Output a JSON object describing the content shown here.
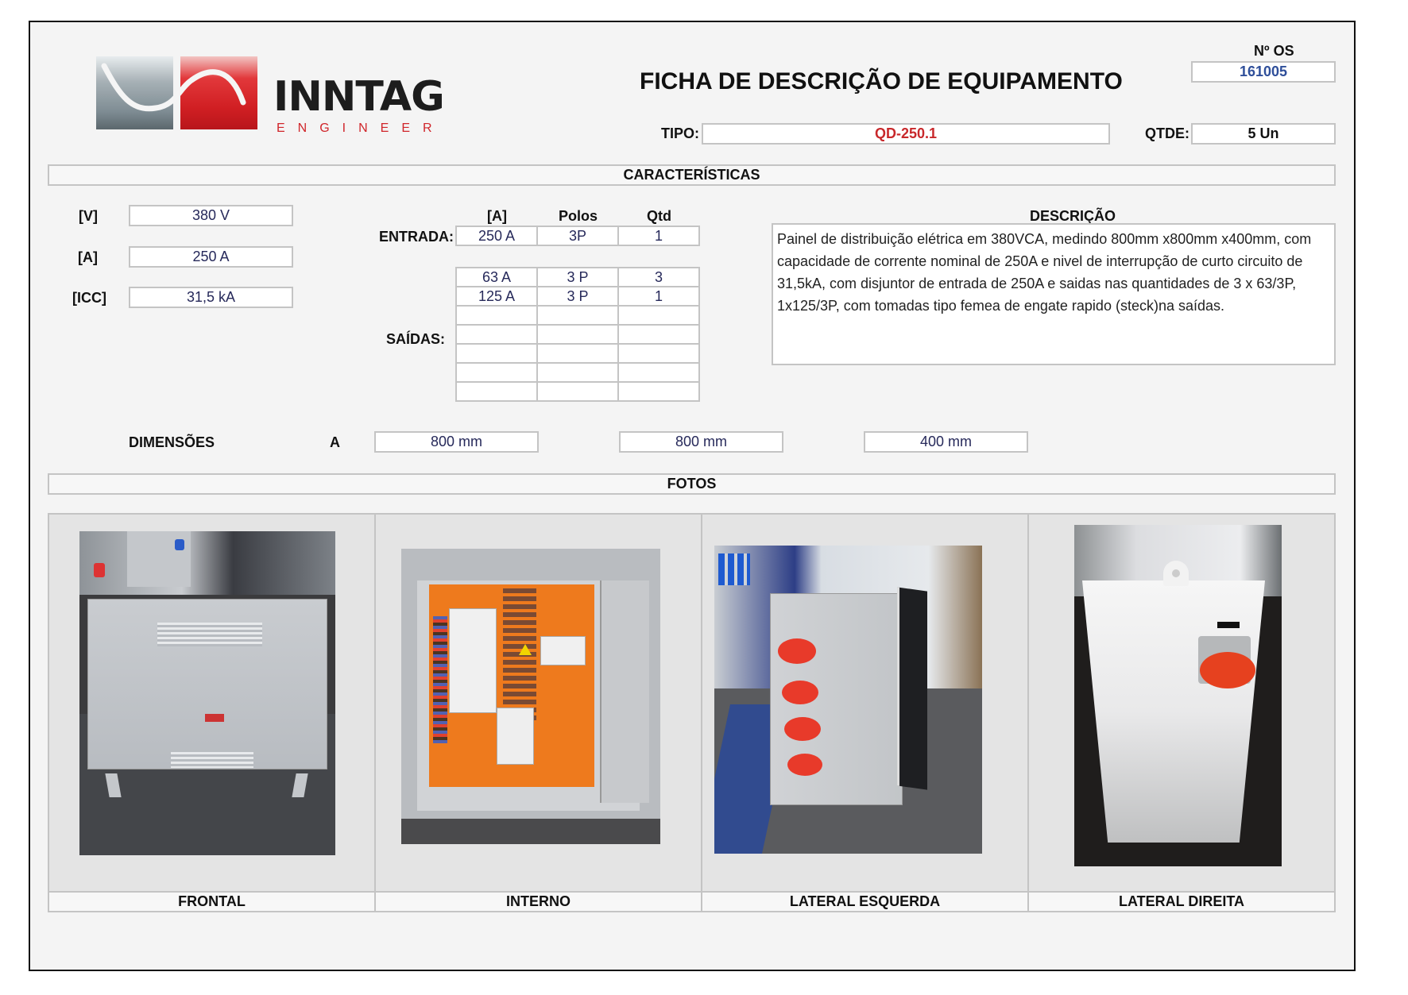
{
  "header": {
    "logo_name": "INNTAG",
    "logo_tagline": "ENGINEER",
    "title": "FICHA DE DESCRIÇÃO DE EQUIPAMENTO",
    "os_label": "Nº OS",
    "os_value": "161005",
    "tipo_label": "TIPO:",
    "tipo_value": "QD-250.1",
    "qtde_label": "QTDE:",
    "qtde_value": "5 Un"
  },
  "colors": {
    "brand_red": "#d0252a",
    "tipo_value": "#c8282b",
    "os_value": "#2f4f9a",
    "value_text": "#26295a",
    "border": "#c4c4c4"
  },
  "caracteristicas": {
    "section_title": "CARACTERÍSTICAS",
    "specs": [
      {
        "label": "[V]",
        "value": "380 V"
      },
      {
        "label": "[A]",
        "value": "250 A"
      },
      {
        "label": "[ICC]",
        "value": "31,5 kA"
      }
    ],
    "table_headers": [
      "[A]",
      "Polos",
      "Qtd"
    ],
    "entrada_label": "ENTRADA:",
    "entrada": {
      "a": "250 A",
      "polos": "3P",
      "qtd": "1"
    },
    "saidas_label": "SAÍDAS:",
    "saidas": [
      {
        "a": "63 A",
        "polos": "3 P",
        "qtd": "3"
      },
      {
        "a": "125 A",
        "polos": "3 P",
        "qtd": "1"
      },
      {
        "a": "",
        "polos": "",
        "qtd": ""
      },
      {
        "a": "",
        "polos": "",
        "qtd": ""
      },
      {
        "a": "",
        "polos": "",
        "qtd": ""
      },
      {
        "a": "",
        "polos": "",
        "qtd": ""
      },
      {
        "a": "",
        "polos": "",
        "qtd": ""
      }
    ],
    "descricao_label": "DESCRIÇÃO",
    "descricao": "Painel de distribuição elétrica em 380VCA, medindo 800mm x800mm x400mm, com capacidade de corrente nominal de 250A e nivel de interrupção de curto circuito de 31,5kA, com disjuntor de entrada de 250A  e saidas nas quantidades de 3 x 63/3P, 1x125/3P, com tomadas tipo femea de engate rapido (steck)na saídas.",
    "dimensoes_label": "DIMENSÕES",
    "dimensoes_prefix": "A",
    "dimensoes": [
      "800 mm",
      "800 mm",
      "400 mm"
    ]
  },
  "fotos": {
    "section_title": "FOTOS",
    "items": [
      {
        "caption": "FRONTAL",
        "subject": "front-view-photo"
      },
      {
        "caption": "INTERNO",
        "subject": "internal-view-photo"
      },
      {
        "caption": "LATERAL ESQUERDA",
        "subject": "left-side-photo"
      },
      {
        "caption": "LATERAL DIREITA",
        "subject": "right-side-photo"
      }
    ]
  }
}
